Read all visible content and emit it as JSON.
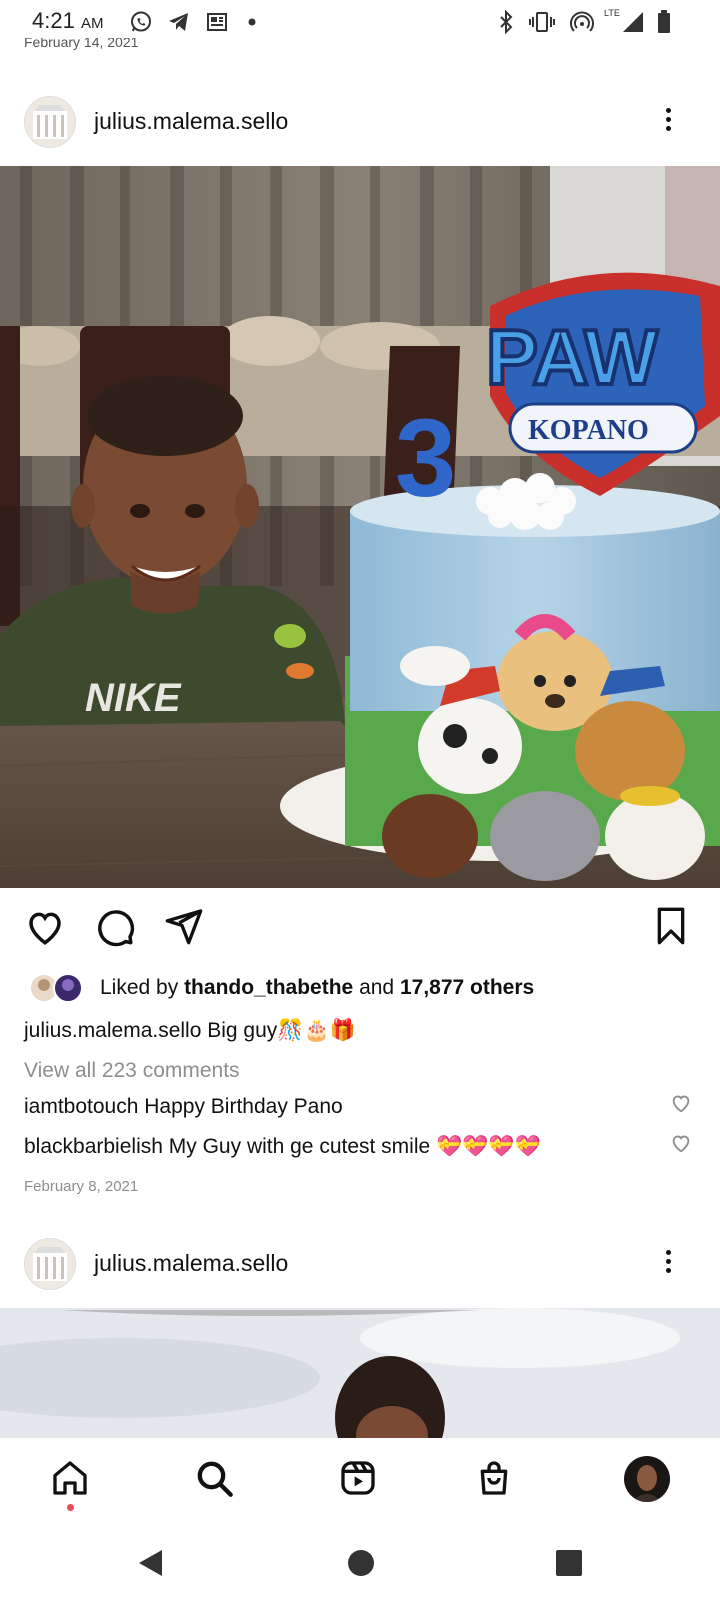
{
  "status_bar": {
    "time": "4:21",
    "ampm": "AM",
    "network_label": "LTE"
  },
  "previous_post": {
    "date_fragment": "February 14, 2021"
  },
  "post": {
    "username": "julius.malema.sello",
    "photo_cake_topper_number": "3",
    "photo_topper_title": "PAW",
    "photo_topper_name": "KOPANO",
    "photo_shirt_text": "NIKE",
    "liked_by_prefix": "Liked by",
    "liked_by_user": "thando_thabethe",
    "liked_by_and": "and",
    "liked_by_count": "17,877 others",
    "caption_user": "julius.malema.sello",
    "caption_text": "Big guy🎊🎂🎁",
    "view_all_comments": "View all 223 comments",
    "comments": [
      {
        "user": "iamtbotouch",
        "text": "Happy Birthday Pano"
      },
      {
        "user": "blackbarbielish",
        "text": "My Guy with ge cutest smile 💝💝💝💝"
      }
    ],
    "date": "February 8, 2021"
  },
  "next_post": {
    "username": "julius.malema.sello"
  },
  "icons": {
    "like": "heart-icon",
    "comment": "comment-bubble-icon",
    "share": "paper-plane-icon",
    "save": "bookmark-icon",
    "home": "home-icon",
    "search": "search-icon",
    "reels": "reels-icon",
    "shop": "shopping-bag-icon"
  },
  "colors": {
    "notification_dot": "#ed4956",
    "muted_text": "#8e8e8e"
  }
}
